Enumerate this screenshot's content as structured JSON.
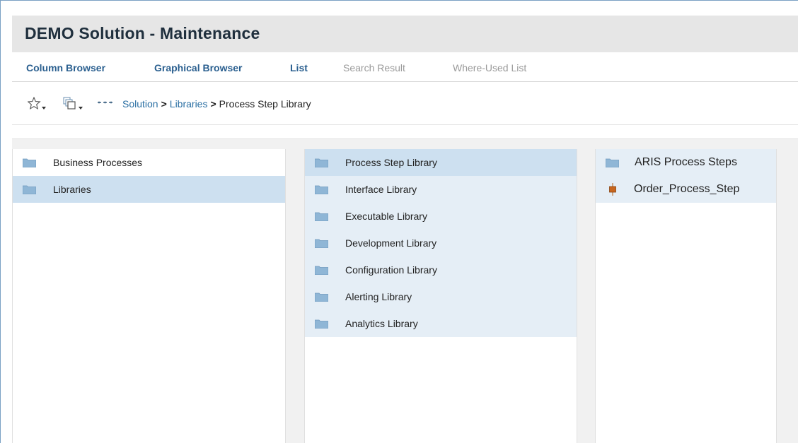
{
  "header": {
    "title": "DEMO Solution - Maintenance"
  },
  "tabs": [
    {
      "label": "Column Browser",
      "active": true
    },
    {
      "label": "Graphical Browser",
      "active": true
    },
    {
      "label": "List",
      "active": true
    },
    {
      "label": "Search Result",
      "active": false
    },
    {
      "label": "Where-Used List",
      "active": false
    }
  ],
  "toolbar": {
    "icons": [
      "star-icon",
      "copy-windows-icon",
      "ellipsis-icon"
    ]
  },
  "breadcrumb": {
    "items": [
      "Solution",
      "Libraries"
    ],
    "separator": ">",
    "current": "Process Step Library"
  },
  "columns": {
    "col1": {
      "items": [
        {
          "label": "Business Processes",
          "icon": "folder-icon"
        },
        {
          "label": "Libraries",
          "icon": "folder-icon",
          "selected": true
        }
      ]
    },
    "col2": {
      "items": [
        {
          "label": "Process Step Library",
          "icon": "folder-icon",
          "selected": true
        },
        {
          "label": "Interface Library",
          "icon": "folder-icon"
        },
        {
          "label": "Executable Library",
          "icon": "folder-icon"
        },
        {
          "label": "Development Library",
          "icon": "folder-icon"
        },
        {
          "label": "Configuration Library",
          "icon": "folder-icon"
        },
        {
          "label": "Alerting Library",
          "icon": "folder-icon"
        },
        {
          "label": "Analytics Library",
          "icon": "folder-icon"
        }
      ]
    },
    "col3": {
      "items": [
        {
          "label": "ARIS Process Steps",
          "icon": "folder-icon"
        },
        {
          "label": "Order_Process_Step",
          "icon": "process-step-icon"
        }
      ]
    }
  },
  "colors": {
    "title_bg": "#e6e6e6",
    "tab_active": "#2a5f8f",
    "tab_inactive": "#9a9a9a",
    "link": "#2a6fa3",
    "selected_row": "#cde0f0",
    "tinted_row": "#e5eef6",
    "folder": "#8fb6d6"
  }
}
